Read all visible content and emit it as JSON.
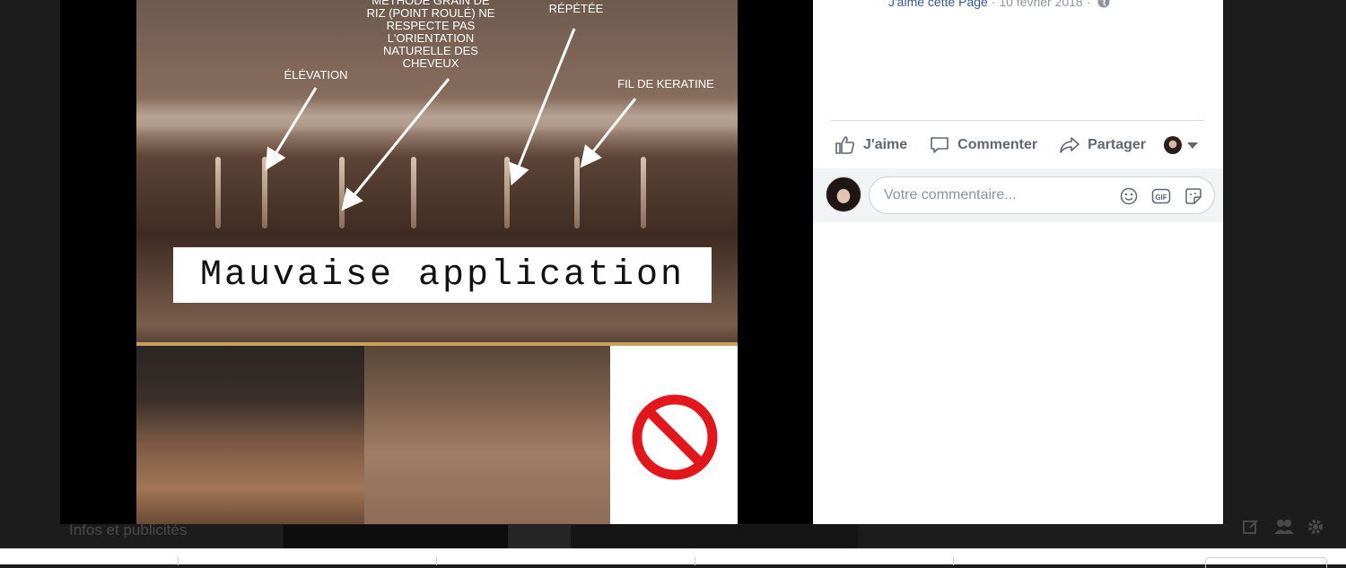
{
  "post": {
    "page_link": "J'aime cette Page",
    "separator": " · ",
    "date": "10 février 2018",
    "separator2": " · "
  },
  "photo": {
    "labels": {
      "grain_method": "MÉTHODE GRAIN DE RIZ (POINT ROULÉ) NE RESPECTE PAS L'ORIENTATION NATURELLE DES CHEVEUX",
      "elevation": "ÉLÉVATION",
      "repeated": "ET L'ATTACHE NON RÉPÉTÉE",
      "keratin": "FIL DE KERATINE"
    },
    "caption": "Mauvaise application"
  },
  "actions": {
    "like": "J'aime",
    "comment": "Commenter",
    "share": "Partager"
  },
  "comment_box": {
    "placeholder": "Votre commentaire..."
  },
  "backdrop": {
    "section_label": "Infos et publicités"
  },
  "icons": {
    "like": "thumbs-up-icon",
    "comment": "speech-bubble-icon",
    "share": "share-arrow-icon",
    "emoji": "smiley-icon",
    "gif": "gif-icon",
    "sticker": "sticker-icon",
    "globe": "globe-icon",
    "no_sign": "prohibited-icon"
  },
  "colors": {
    "link": "#365899",
    "action_text": "#606770",
    "prohibited_red": "#e2161b",
    "gold_line": "#c8a25a"
  }
}
